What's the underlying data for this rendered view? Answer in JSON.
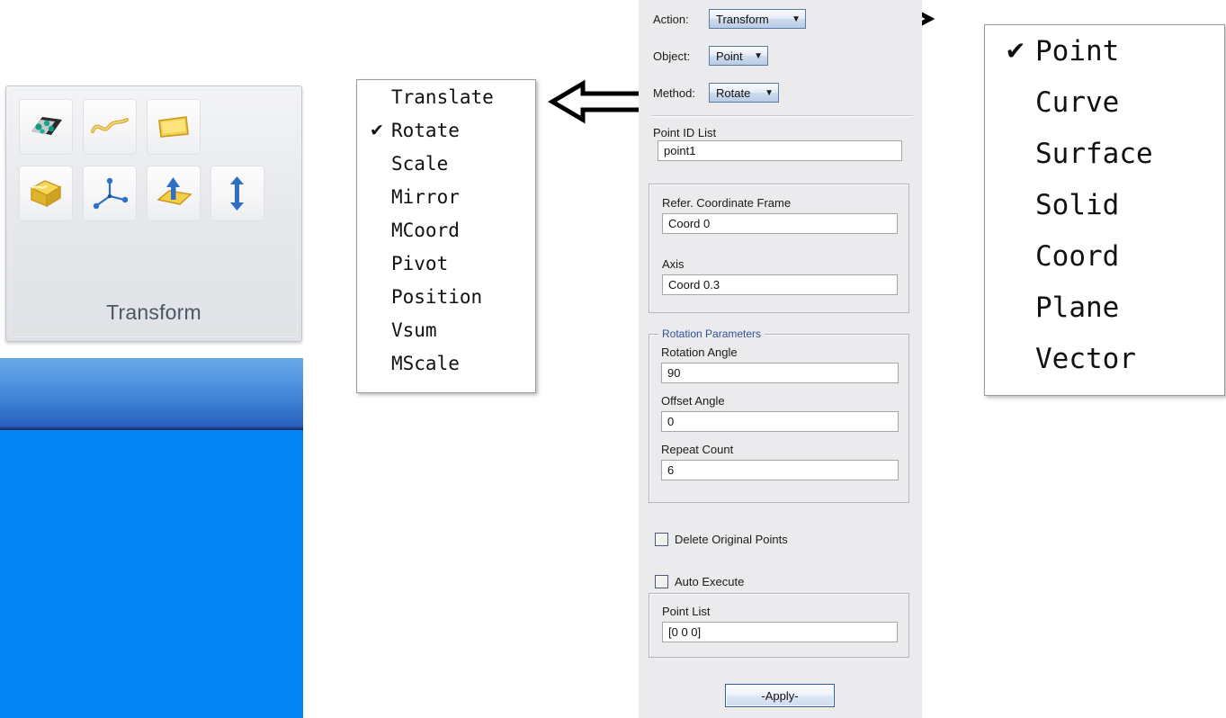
{
  "ribbon": {
    "group_label": "Transform",
    "buttons": [
      {
        "name": "point-cloud-icon",
        "title": "Point"
      },
      {
        "name": "curve-icon",
        "title": "Curve"
      },
      {
        "name": "surface-icon",
        "title": "Surface"
      },
      {
        "name": "solid-icon",
        "title": "Solid"
      },
      {
        "name": "coord-axes-icon",
        "title": "Coord"
      },
      {
        "name": "plane-icon",
        "title": "Plane"
      },
      {
        "name": "vector-icon",
        "title": "Vector"
      }
    ]
  },
  "method_menu": {
    "items": [
      {
        "label": "Translate",
        "checked": false
      },
      {
        "label": "Rotate",
        "checked": true
      },
      {
        "label": "Scale",
        "checked": false
      },
      {
        "label": "Mirror",
        "checked": false
      },
      {
        "label": "MCoord",
        "checked": false
      },
      {
        "label": "Pivot",
        "checked": false
      },
      {
        "label": "Position",
        "checked": false
      },
      {
        "label": "Vsum",
        "checked": false
      },
      {
        "label": "MScale",
        "checked": false
      }
    ],
    "check_glyph": "✔"
  },
  "object_menu": {
    "items": [
      {
        "label": "Point",
        "checked": true
      },
      {
        "label": "Curve",
        "checked": false
      },
      {
        "label": "Surface",
        "checked": false
      },
      {
        "label": "Solid",
        "checked": false
      },
      {
        "label": "Coord",
        "checked": false
      },
      {
        "label": "Plane",
        "checked": false
      },
      {
        "label": "Vector",
        "checked": false
      }
    ],
    "check_glyph": "✔"
  },
  "panel": {
    "action": {
      "label": "Action:",
      "value": "Transform"
    },
    "object": {
      "label": "Object:",
      "value": "Point"
    },
    "method": {
      "label": "Method:",
      "value": "Rotate"
    },
    "caret_glyph": "▼",
    "point_id_list": {
      "label": "Point ID List",
      "value": "point1"
    },
    "refer_frame_group": {
      "frame_label": "Refer. Coordinate Frame",
      "frame_value": "Coord 0",
      "axis_label": "Axis",
      "axis_value": "Coord 0.3"
    },
    "rotation_parameters": {
      "title": "Rotation Parameters",
      "fields": [
        {
          "label": "Rotation Angle",
          "value": "90"
        },
        {
          "label": "Offset Angle",
          "value": "0"
        },
        {
          "label": "Repeat Count",
          "value": "6"
        }
      ]
    },
    "delete_original_points": {
      "label": "Delete Original Points",
      "checked": false
    },
    "auto_execute": {
      "label": "Auto Execute",
      "checked": false
    },
    "point_list_group": {
      "label": "Point List",
      "value": "[0 0 0]"
    },
    "apply_button": "-Apply-"
  },
  "annotations": {
    "arrow_right": "arrow-pointing-right",
    "arrow_left": "arrow-pointing-left"
  },
  "colors": {
    "panel_bg": "#ebeaed",
    "viewport_blue": "#0485f4",
    "titlebar_blue": "#3c7fd4",
    "accent_blue": "#2a5fa8",
    "group_title_blue": "#32509a"
  }
}
